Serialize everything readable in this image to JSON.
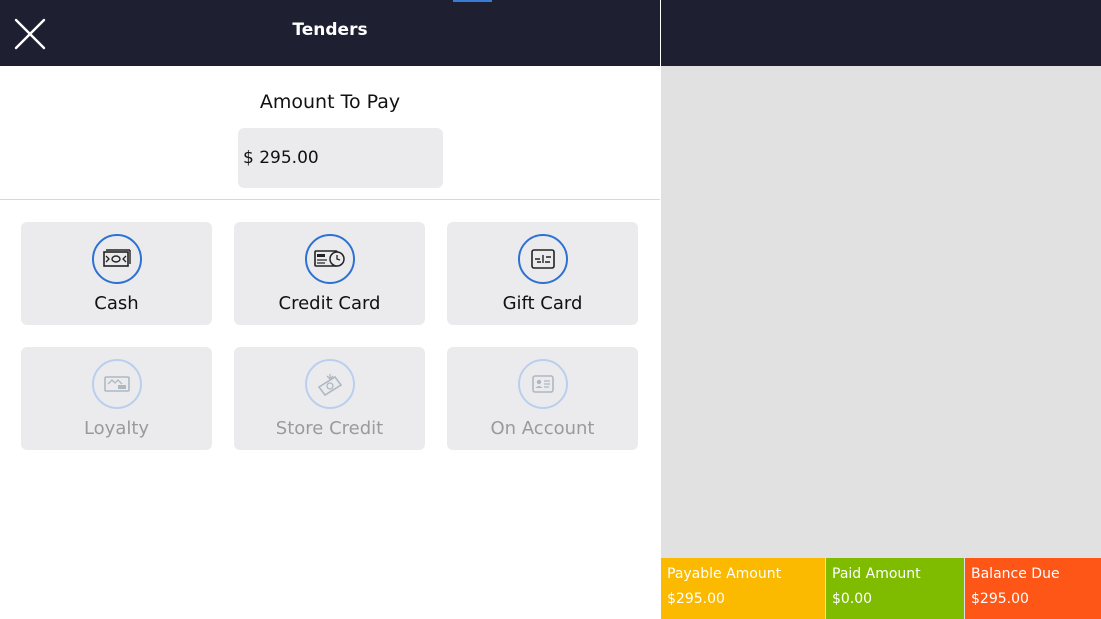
{
  "header": {
    "title": "Tenders",
    "close_icon": "close-icon"
  },
  "payment": {
    "amount_label": "Amount To Pay",
    "amount_value": "$ 295.00"
  },
  "tenders": [
    {
      "label": "Cash",
      "icon": "cash-icon",
      "enabled": true
    },
    {
      "label": "Credit Card",
      "icon": "credit-card-icon",
      "enabled": true
    },
    {
      "label": "Gift Card",
      "icon": "gift-card-icon",
      "enabled": true
    },
    {
      "label": "Loyalty",
      "icon": "loyalty-icon",
      "enabled": false
    },
    {
      "label": "Store Credit",
      "icon": "store-credit-icon",
      "enabled": false
    },
    {
      "label": "On Account",
      "icon": "on-account-icon",
      "enabled": false
    }
  ],
  "summary": {
    "payable": {
      "label": "Payable Amount",
      "value": "$295.00",
      "color": "#fbb900"
    },
    "paid": {
      "label": "Paid Amount",
      "value": "$0.00",
      "color": "#7fbc00"
    },
    "balance": {
      "label": "Balance Due",
      "value": "$295.00",
      "color": "#fd5616"
    }
  },
  "colors": {
    "header": "#1e2032",
    "accent": "#2d72d2",
    "tile": "#ebebee",
    "right_panel": "#e1e1e1"
  }
}
